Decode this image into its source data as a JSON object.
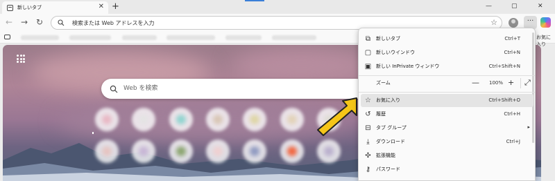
{
  "browser": {
    "tab": {
      "title": "新しいタブ",
      "icon": "new-tab-page-icon"
    },
    "window_buttons": [
      "—",
      "▢",
      "✕"
    ],
    "address_bar": {
      "placeholder": "検索または Web アドレスを入力"
    },
    "favorites_overflow": "お気に入り"
  },
  "ntp": {
    "search_placeholder": "Web を検索",
    "tiles": [
      {
        "color": "#e8b7c3"
      },
      {
        "color": "#e4e4e4"
      },
      {
        "color": "#8fd4cf"
      },
      {
        "color": "#d8c6b4"
      },
      {
        "color": "#ded6a5"
      },
      {
        "color": "#e2d3b8"
      },
      {
        "color": "#dedcd4"
      },
      {
        "color": "#e6c4c0"
      },
      {
        "color": "#c7b5d5"
      },
      {
        "color": "#8aa46e"
      },
      {
        "color": "#efd0d0"
      },
      {
        "color": "#8f99c0"
      },
      {
        "color": "#f2653e"
      },
      {
        "color": "#b9afcc"
      }
    ]
  },
  "menu": {
    "items": [
      {
        "label": "新しいタブ",
        "shortcut": "Ctrl+T",
        "icon": "new-tab-icon"
      },
      {
        "label": "新しいウインドウ",
        "shortcut": "Ctrl+N",
        "icon": "new-window-icon"
      },
      {
        "label": "新しい InPrivate ウィンドウ",
        "shortcut": "Ctrl+Shift+N",
        "icon": "inprivate-icon"
      }
    ],
    "zoom": {
      "label": "ズーム",
      "value": "100%",
      "minus": "—",
      "plus": "+"
    },
    "items2": [
      {
        "label": "お気に入り",
        "shortcut": "Ctrl+Shift+O",
        "icon": "favorites-star-icon"
      },
      {
        "label": "履歴",
        "shortcut": "Ctrl+H",
        "icon": "history-icon"
      },
      {
        "label": "タブ グループ",
        "shortcut": "",
        "submenu": "▸",
        "icon": "tab-groups-icon"
      },
      {
        "label": "ダウンロード",
        "shortcut": "Ctrl+J",
        "icon": "download-icon"
      },
      {
        "label": "拡張機能",
        "shortcut": "",
        "icon": "extensions-icon"
      },
      {
        "label": "パスワード",
        "shortcut": "",
        "icon": "key-icon"
      }
    ]
  },
  "colors": {
    "highlight": "#e4e4e4",
    "arrow_fill": "#f5c518",
    "arrow_stroke": "#222222"
  }
}
